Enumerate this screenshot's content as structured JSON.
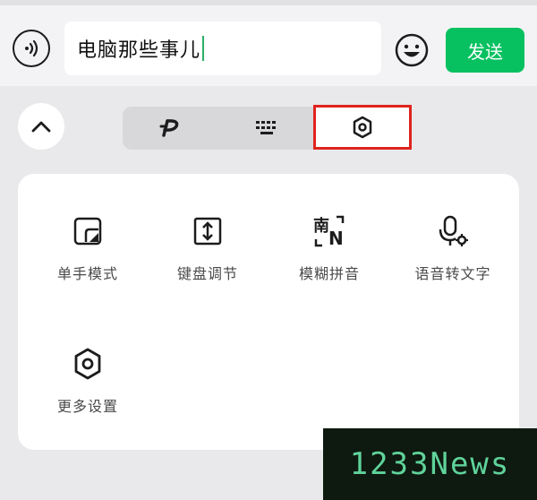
{
  "input": {
    "value": "电脑那些事儿"
  },
  "send_label": "发送",
  "tabs": [
    {
      "icon": "p-handwriting-icon"
    },
    {
      "icon": "keyboard-icon"
    },
    {
      "icon": "hexagon-settings-icon",
      "selected": true
    }
  ],
  "tiles": [
    {
      "icon": "one-hand-mode-icon",
      "label": "单手模式"
    },
    {
      "icon": "keyboard-resize-icon",
      "label": "键盘调节"
    },
    {
      "icon": "fuzzy-pinyin-icon",
      "icon_text": "南",
      "icon_text2": "N",
      "label": "模糊拼音"
    },
    {
      "icon": "voice-to-text-icon",
      "label": "语音转文字"
    },
    {
      "icon": "more-settings-icon",
      "label": "更多设置"
    }
  ],
  "watermark": "1233News",
  "colors": {
    "accent": "#07c160",
    "highlight_border": "#e0231d"
  }
}
